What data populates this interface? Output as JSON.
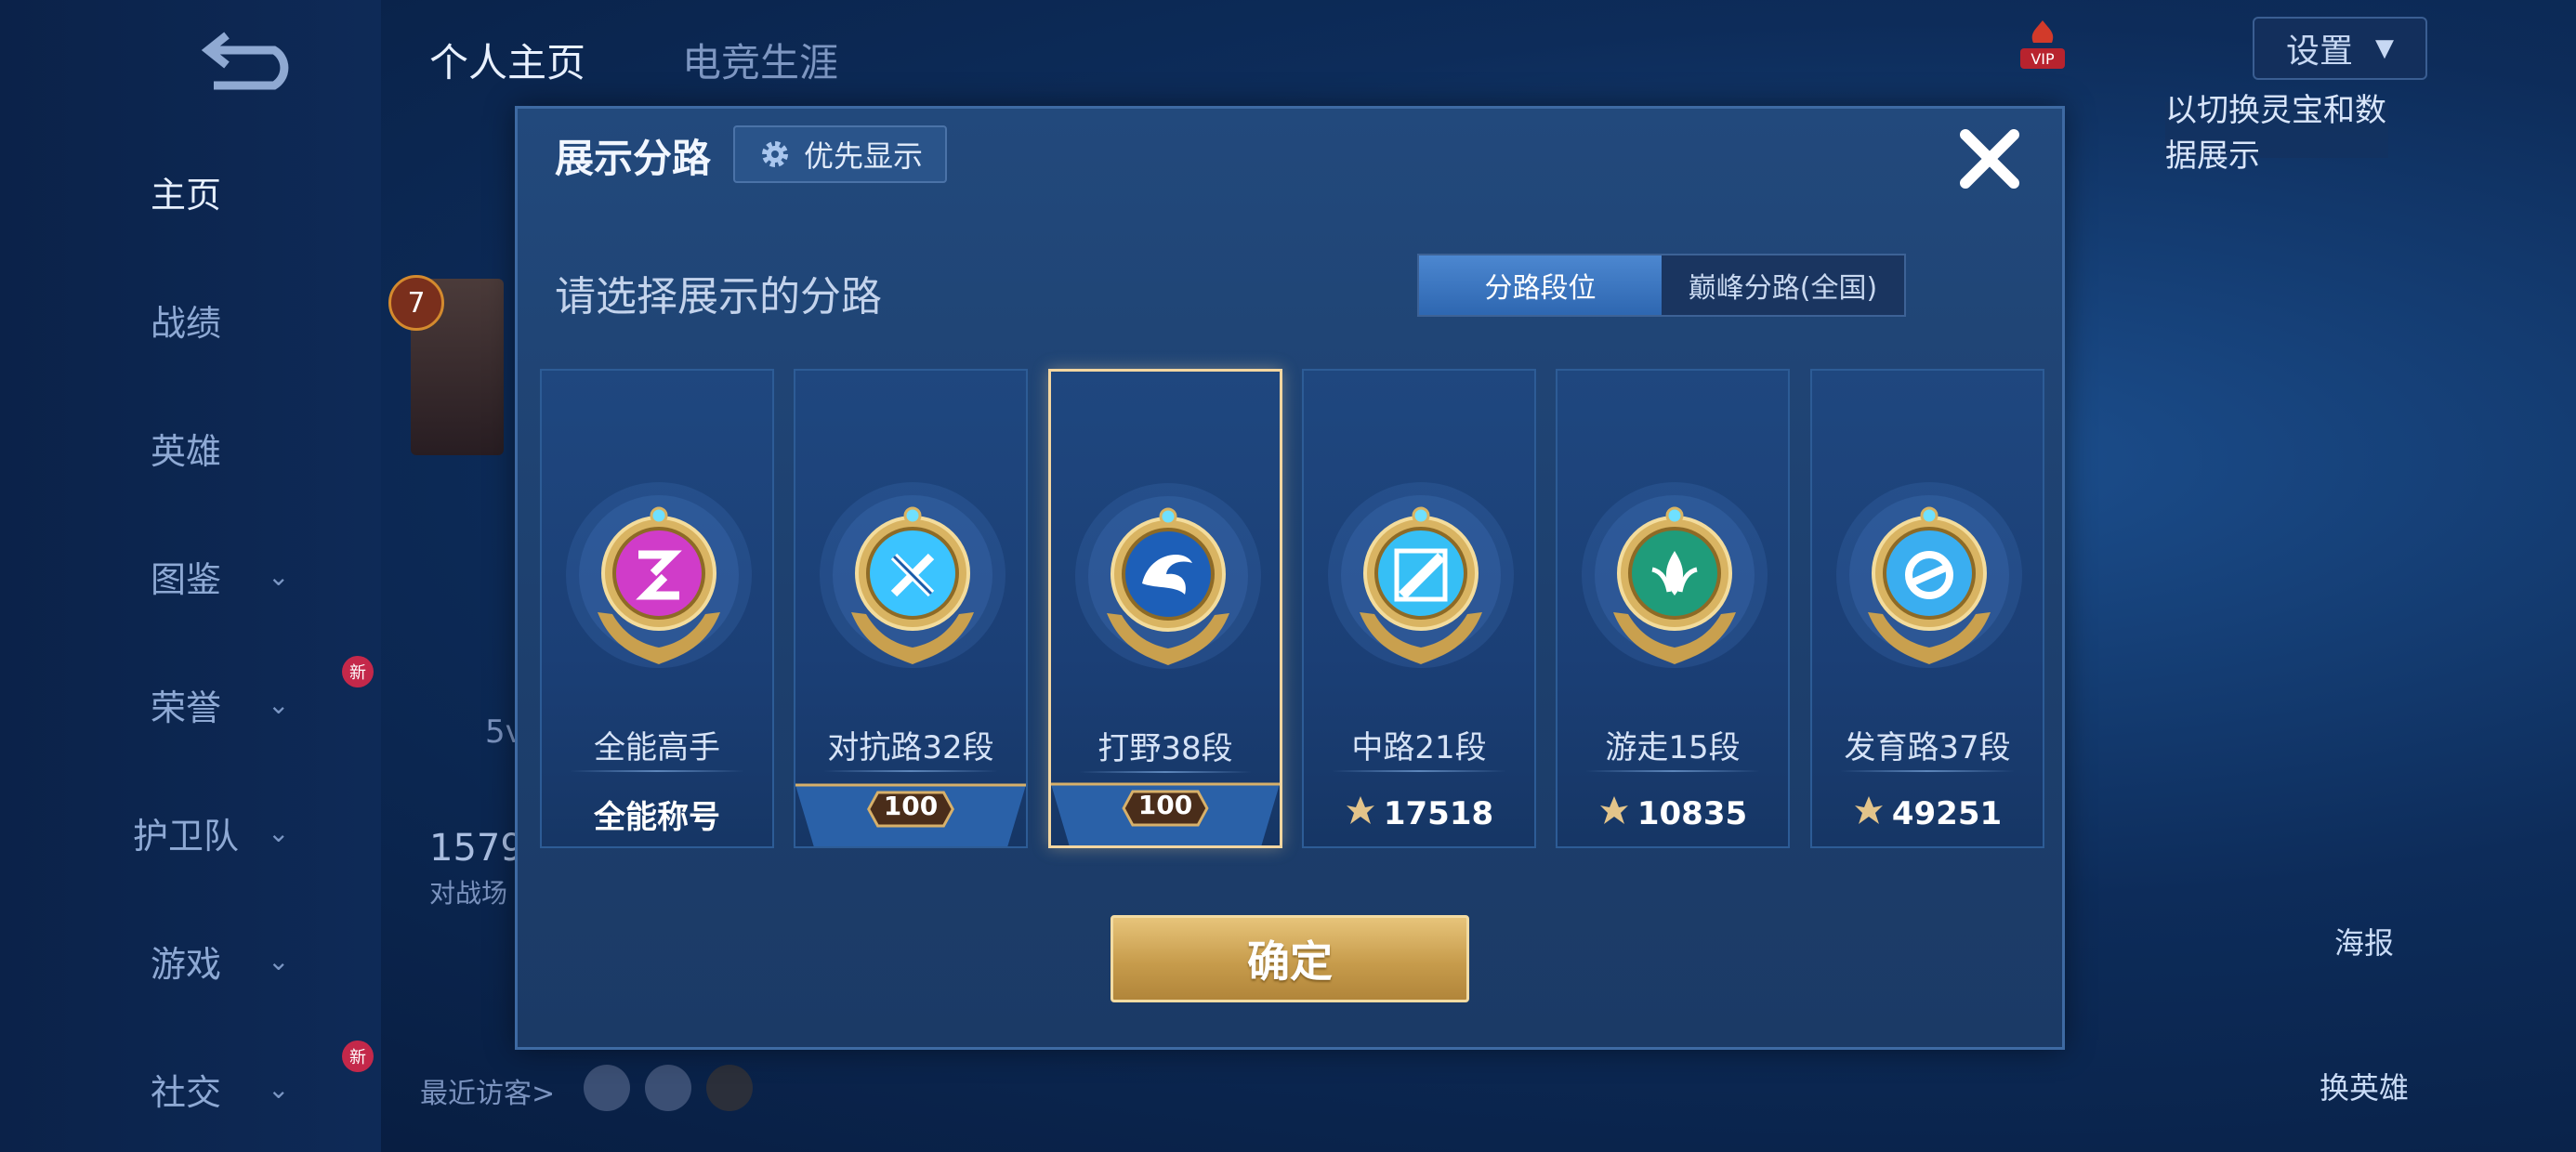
{
  "background": {
    "top_tabs": [
      "个人主页",
      "电竞生涯"
    ],
    "sidebar": [
      {
        "label": "主页",
        "active": true,
        "chevron": false,
        "badge": ""
      },
      {
        "label": "战绩",
        "active": false,
        "chevron": false,
        "badge": ""
      },
      {
        "label": "英雄",
        "active": false,
        "chevron": false,
        "badge": ""
      },
      {
        "label": "图鉴",
        "active": false,
        "chevron": true,
        "badge": ""
      },
      {
        "label": "荣誉",
        "active": false,
        "chevron": true,
        "badge": "新"
      },
      {
        "label": "护卫队",
        "active": false,
        "chevron": true,
        "badge": ""
      },
      {
        "label": "游戏",
        "active": false,
        "chevron": true,
        "badge": ""
      },
      {
        "label": "社交",
        "active": false,
        "chevron": true,
        "badge": "新"
      }
    ],
    "settings_label": "设置",
    "vip_label": "VIP",
    "hint_text": "以切换灵宝和数据展示",
    "level_badge": "7",
    "stat_partial": "1579",
    "stat_caption_partial": "对战场",
    "mode_partial": "5v",
    "recent_visitors_label": "最近访客>",
    "right_buttons": {
      "poster": "海报",
      "swap_hero": "换英雄"
    }
  },
  "dialog": {
    "title": "展示分路",
    "priority_label": "优先显示",
    "subtitle": "请选择展示的分路",
    "segments": [
      "分路段位",
      "巅峰分路(全国)"
    ],
    "active_segment": 0,
    "confirm_label": "确定",
    "cards": [
      {
        "name": "全能高手",
        "bottom_text": "全能称号",
        "bottom_type": "text",
        "icon": "all-round-medal-icon",
        "gem_color": "#d03cc9",
        "selected": false
      },
      {
        "name": "对抗路32段",
        "bottom_text": "100",
        "bottom_type": "banner",
        "icon": "clash-lane-medal-icon",
        "gem_color": "#3bc4ff",
        "selected": false
      },
      {
        "name": "打野38段",
        "bottom_text": "100",
        "bottom_type": "banner",
        "icon": "jungle-medal-icon",
        "gem_color": "#1d5fb8",
        "selected": true
      },
      {
        "name": "中路21段",
        "bottom_text": "17518",
        "bottom_type": "score",
        "icon": "mid-lane-medal-icon",
        "gem_color": "#36bff5",
        "selected": false
      },
      {
        "name": "游走15段",
        "bottom_text": "10835",
        "bottom_type": "score",
        "icon": "roam-medal-icon",
        "gem_color": "#1f9c7a",
        "selected": false
      },
      {
        "name": "发育路37段",
        "bottom_text": "49251",
        "bottom_type": "score",
        "icon": "farm-lane-medal-icon",
        "gem_color": "#3aaef0",
        "selected": false
      }
    ]
  }
}
